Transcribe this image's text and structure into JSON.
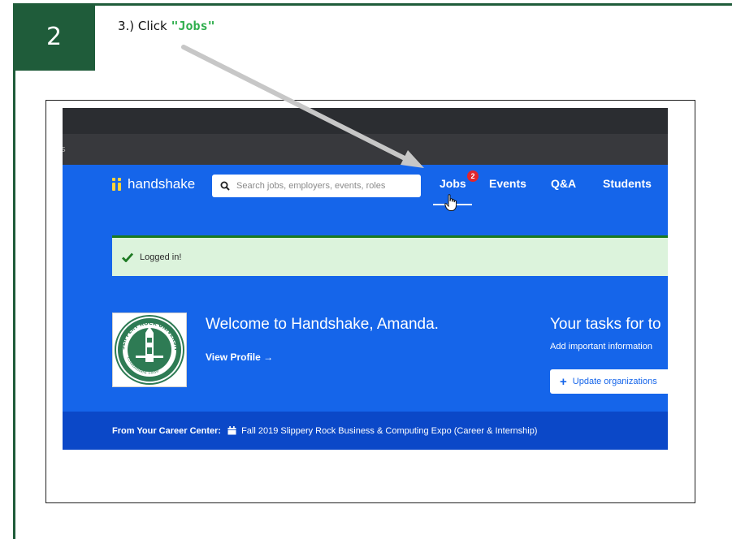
{
  "tutorial": {
    "step_number": "2",
    "instruction_prefix": "3.) Click ",
    "instruction_target": "\"Jobs\""
  },
  "browser": {
    "partial_text": "s"
  },
  "navbar": {
    "brand": "handshake",
    "search_placeholder": "Search jobs, employers, events, roles",
    "items": [
      {
        "label": "Jobs",
        "badge": "2"
      },
      {
        "label": "Events"
      },
      {
        "label": "Q&A"
      },
      {
        "label": "Students"
      }
    ]
  },
  "alert": {
    "message": "Logged in!"
  },
  "welcome": {
    "title": "Welcome to Handshake, Amanda.",
    "view_profile": "View Profile →",
    "seal_name": "SLIPPERY ROCK UNIVERSITY",
    "seal_established": "Established 1889"
  },
  "tasks": {
    "title": "Your tasks for to",
    "subtitle": "Add important information",
    "button_label": "Update organizations"
  },
  "career_bar": {
    "label": "From Your Career Center:",
    "event": "Fall 2019 Slippery Rock Business & Computing Expo (Career & Internship)"
  },
  "colors": {
    "tutorial_green": "#1f5c3a",
    "highlight_green": "#2eae4c",
    "handshake_blue": "#1565ea",
    "career_bar_blue": "#0b48c8",
    "badge_red": "#e0262d",
    "logo_yellow": "#fdd33a"
  }
}
